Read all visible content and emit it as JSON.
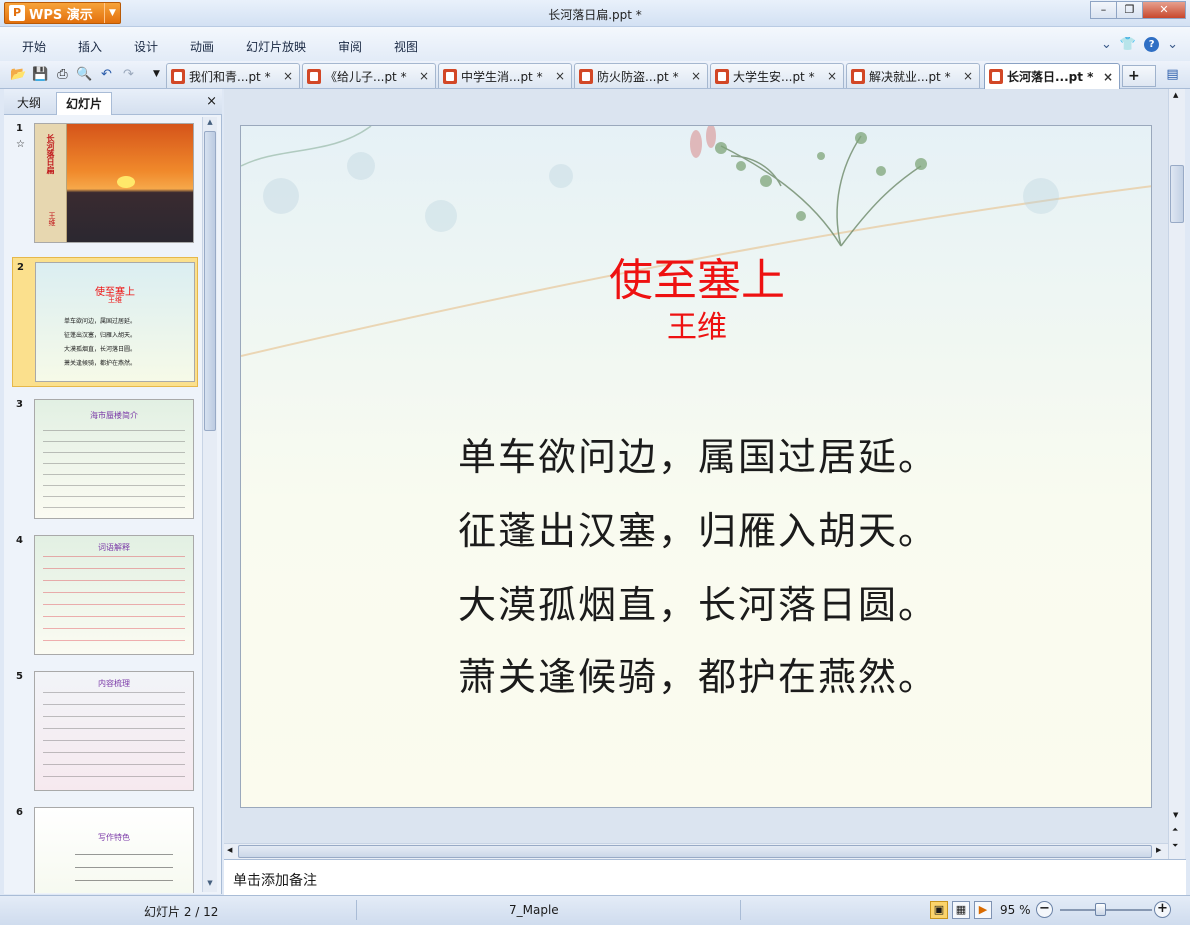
{
  "window": {
    "app_button": "WPS 演示",
    "title": "长河落日扁.ppt *",
    "min_icon": "minimize-icon",
    "max_icon": "restore-icon",
    "close_icon": "close-icon"
  },
  "menu": {
    "items": [
      "开始",
      "插入",
      "设计",
      "动画",
      "幻灯片放映",
      "审阅",
      "视图"
    ]
  },
  "tabs": [
    {
      "label": "我们和青...pt *",
      "close": "×"
    },
    {
      "label": "《给儿子...pt *",
      "close": "×"
    },
    {
      "label": "中学生消...pt *",
      "close": "×"
    },
    {
      "label": "防火防盗...pt *",
      "close": "×"
    },
    {
      "label": "大学生安...pt *",
      "close": "×"
    },
    {
      "label": "解决就业...pt *",
      "close": "×"
    },
    {
      "label": "长河落日...pt *",
      "close": "×"
    }
  ],
  "panel": {
    "tab_outline": "大纲",
    "tab_slides": "幻灯片",
    "close": "×"
  },
  "slide_thumbs": [
    {
      "num": "1",
      "title": "长河落日扁",
      "author": "王维"
    },
    {
      "num": "2",
      "title": "使至塞上",
      "author": "王维",
      "lines": [
        "单车欲问边，属国过居延。",
        "征蓬出汉塞，归雁入胡天。",
        "大漠孤烟直，长河落日圆。",
        "萧关逢候骑，都护在燕然。"
      ]
    },
    {
      "num": "3",
      "title": "海市蜃楼简介"
    },
    {
      "num": "4",
      "title": "词语解释"
    },
    {
      "num": "5",
      "title": "内容梳理"
    },
    {
      "num": "6",
      "title": "写作特色"
    }
  ],
  "slide": {
    "title": "使至塞上",
    "author": "王维",
    "lines": [
      "单车欲问边，属国过居延。",
      "征蓬出汉塞，归雁入胡天。",
      "大漠孤烟直，长河落日圆。",
      "萧关逢候骑，都护在燕然。"
    ],
    "title_color": "#ee1111"
  },
  "notes": {
    "placeholder": "单击添加备注"
  },
  "status": {
    "slide_count": "幻灯片 2 / 12",
    "theme": "7_Maple",
    "zoom": "95 %"
  }
}
